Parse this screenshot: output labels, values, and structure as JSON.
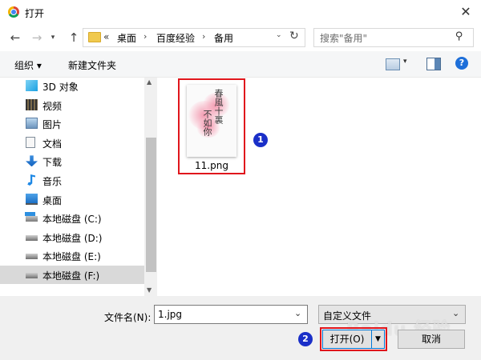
{
  "window": {
    "title": "打开",
    "close_glyph": "✕"
  },
  "nav": {
    "back_glyph": "←",
    "forward_glyph": "→",
    "recent_glyph": "▾",
    "up_glyph": "↑",
    "address": {
      "overflow": "«",
      "crumbs": [
        "桌面",
        "百度经验",
        "备用"
      ],
      "separator": "›",
      "dropdown_glyph": "⌄",
      "refresh_glyph": "↻"
    },
    "search": {
      "placeholder": "搜索\"备用\"",
      "icon_glyph": "⚲"
    }
  },
  "toolbar": {
    "organize_label": "组织 ▾",
    "new_folder_label": "新建文件夹",
    "view_arrow": "▾",
    "help_glyph": "?"
  },
  "sidebar": {
    "items": [
      {
        "label": "3D 对象",
        "icon": "cube-3d-icon"
      },
      {
        "label": "视频",
        "icon": "video-icon"
      },
      {
        "label": "图片",
        "icon": "pictures-icon"
      },
      {
        "label": "文档",
        "icon": "documents-icon"
      },
      {
        "label": "下载",
        "icon": "download-icon"
      },
      {
        "label": "音乐",
        "icon": "music-icon"
      },
      {
        "label": "桌面",
        "icon": "desktop-icon"
      },
      {
        "label": "本地磁盘 (C:)",
        "icon": "windows-drive-icon"
      },
      {
        "label": "本地磁盘 (D:)",
        "icon": "drive-icon"
      },
      {
        "label": "本地磁盘 (E:)",
        "icon": "drive-icon"
      },
      {
        "label": "本地磁盘 (F:)",
        "icon": "drive-icon",
        "selected": true
      }
    ],
    "scroll_up": "▲",
    "scroll_down": "▼"
  },
  "content": {
    "files": [
      {
        "name": "11.png"
      }
    ],
    "thumbnail_text": [
      "春風十裏",
      "不如你"
    ]
  },
  "annotations": {
    "badge_1": "1",
    "badge_2": "2"
  },
  "footer": {
    "filename_label": "文件名(N):",
    "filename_value": "1.jpg",
    "filename_arrow": "⌄",
    "filetype_value": "自定义文件",
    "filetype_arrow": "⌄",
    "open_label": "打开(O)",
    "open_split_glyph": "▼",
    "cancel_label": "取消"
  },
  "watermark": "Baidu 经验",
  "colors": {
    "highlight_box": "#e0161c",
    "badge": "#1a2fc8",
    "selected_row": "#d9d9d9",
    "accent": "#0078d7"
  }
}
